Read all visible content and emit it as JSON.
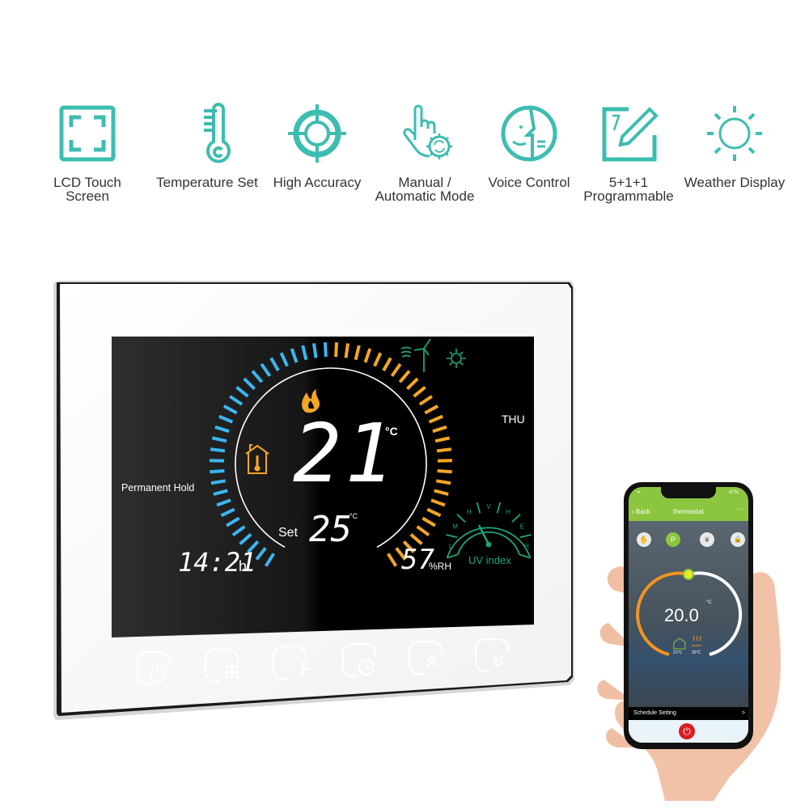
{
  "features": [
    {
      "icon": "lcd-touch-screen-icon",
      "label": "LCD Touch Screen"
    },
    {
      "icon": "thermometer-icon",
      "label": "Temperature Set"
    },
    {
      "icon": "crosshair-target-icon",
      "label": "High Accuracy"
    },
    {
      "icon": "hand-gear-icon",
      "label": "Manual /\nAutomatic Mode"
    },
    {
      "icon": "voice-face-icon",
      "label": "Voice Control"
    },
    {
      "icon": "calendar-pen-icon",
      "label": "5+1+1\nProgrammable"
    },
    {
      "icon": "sun-icon",
      "label": "Weather Display"
    }
  ],
  "colors": {
    "teal": "#3dbdb0",
    "blue_scale": "#3bb6ef",
    "orange_scale": "#f5a623",
    "green_weather": "#1fa67a",
    "app_green": "#8cc63f",
    "app_orange": "#f29422",
    "power_red": "#d71e22"
  },
  "thermostat": {
    "mode_text": "Permanent Hold",
    "day": "THU",
    "current_temp": "21",
    "current_unit": "°C",
    "set_label": "Set",
    "set_temp": "25",
    "set_unit": "°C",
    "time": "14:21",
    "time_suffix": "h",
    "humidity": "57",
    "humidity_unit": "%RH",
    "uv_label": "UV index",
    "uv_levels": [
      "L",
      "M",
      "H",
      "V",
      "H",
      "E",
      "H"
    ],
    "buttons": [
      {
        "name": "power-button",
        "icon": "power-icon"
      },
      {
        "name": "menu-button",
        "icon": "grid-icon"
      },
      {
        "name": "fan-button",
        "icon": "f-letter-icon"
      },
      {
        "name": "schedule-button",
        "icon": "clock-icon"
      },
      {
        "name": "up-button",
        "icon": "chevron-up-double-icon"
      },
      {
        "name": "down-button",
        "icon": "chevron-down-double-icon"
      }
    ]
  },
  "phone": {
    "battery": "47%",
    "back_label": "Back",
    "title": "thermostat",
    "more_label": "···",
    "temperature": "20.0",
    "unit": "°C",
    "room_temp": "21°C",
    "floor_temp": "25°C",
    "schedule_label": "Schedule Setting",
    "schedule_chevron": ">",
    "power_glyph": "⏻",
    "modes": [
      {
        "icon": "hand-icon",
        "glyph": "✋",
        "active": false
      },
      {
        "icon": "program-icon",
        "glyph": "P",
        "active": true
      },
      {
        "icon": "leaf-icon",
        "glyph": "❦",
        "active": false
      },
      {
        "icon": "lock-icon",
        "glyph": "🔒",
        "active": false
      }
    ]
  }
}
